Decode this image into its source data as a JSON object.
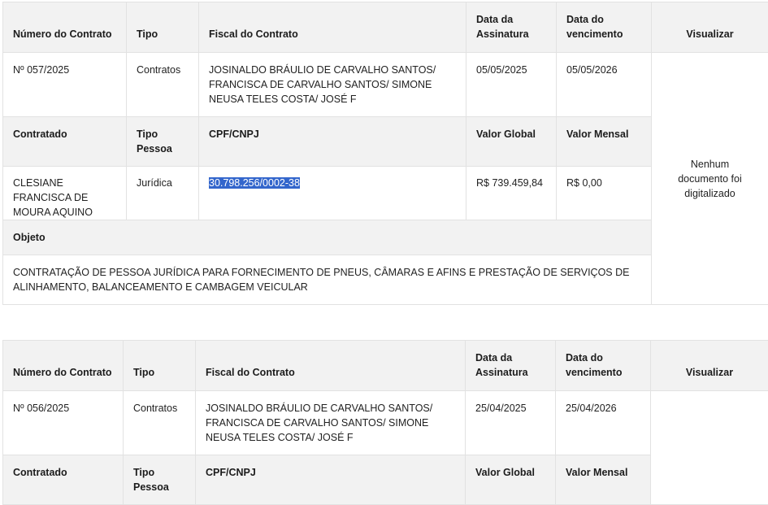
{
  "columns": {
    "numero": "Número do Contrato",
    "tipo": "Tipo",
    "fiscal": "Fiscal do Contrato",
    "data_assinatura": "Data da Assinatura",
    "data_vencimento": "Data do vencimento",
    "visualizar": "Visualizar",
    "contratado": "Contratado",
    "tipo_pessoa": "Tipo Pessoa",
    "cpf_cnpj": "CPF/CNPJ",
    "valor_global": "Valor Global",
    "valor_mensal": "Valor Mensal",
    "objeto": "Objeto"
  },
  "contracts": [
    {
      "numero": "Nº 057/2025",
      "tipo": "Contratos",
      "fiscal": "JOSINALDO BRÁULIO DE CARVALHO SANTOS/ FRANCISCA DE CARVALHO SANTOS/ SIMONE NEUSA TELES COSTA/ JOSÉ F",
      "data_assinatura": "05/05/2025",
      "data_vencimento": "05/05/2026",
      "visualizar": "Nenhum documento foi digitalizado",
      "contratado": "CLESIANE FRANCISCA DE MOURA AQUINO",
      "tipo_pessoa": "Jurídica",
      "cpf_cnpj": "30.798.256/0002-38",
      "valor_global": "R$ 739.459,84",
      "valor_mensal": "R$ 0,00",
      "objeto": "CONTRATAÇÃO DE PESSOA JURÍDICA PARA FORNECIMENTO DE PNEUS, CÂMARAS E AFINS E PRESTAÇÃO DE SERVIÇOS DE ALINHAMENTO, BALANCEAMENTO E CAMBAGEM VEICULAR"
    },
    {
      "numero": "Nº 056/2025",
      "tipo": "Contratos",
      "fiscal": "JOSINALDO BRÁULIO DE CARVALHO SANTOS/ FRANCISCA DE CARVALHO SANTOS/ SIMONE NEUSA TELES COSTA/ JOSÉ F",
      "data_assinatura": "25/04/2025",
      "data_vencimento": "25/04/2026"
    }
  ]
}
